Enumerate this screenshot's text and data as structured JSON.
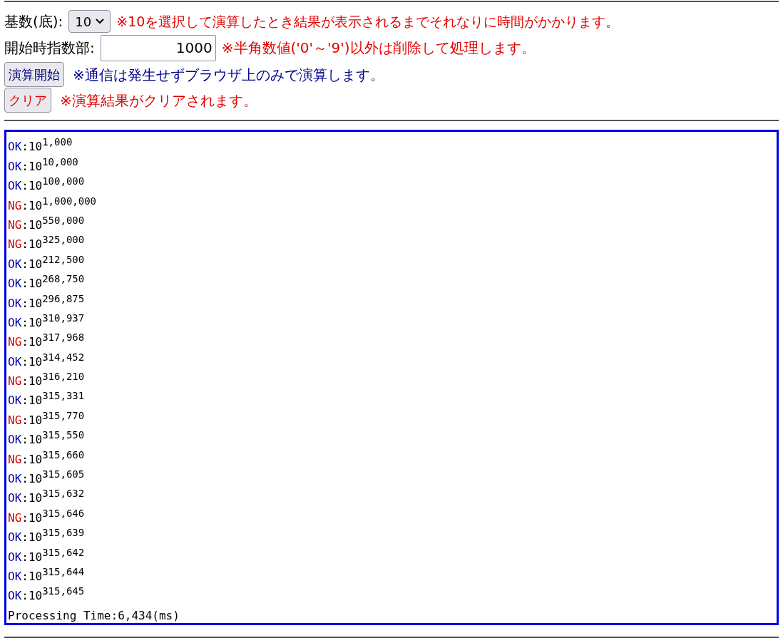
{
  "base_field": {
    "label": "基数(底):",
    "value": "10",
    "note": "※10を選択して演算したとき結果が表示されるまでそれなりに時間がかかります。"
  },
  "exponent_field": {
    "label": "開始時指数部:",
    "value": "1000",
    "note": "※半角数値('0'～'9')以外は削除して処理します。"
  },
  "start_button": {
    "label": "演算開始",
    "note": "※通信は発生せずブラウザ上のみで演算します。"
  },
  "clear_button": {
    "label": "クリア",
    "note": "※演算結果がクリアされます。"
  },
  "results": [
    {
      "status": "OK",
      "ok": true,
      "base": ":10",
      "exponent": "1,000"
    },
    {
      "status": "OK",
      "ok": true,
      "base": ":10",
      "exponent": "10,000"
    },
    {
      "status": "OK",
      "ok": true,
      "base": ":10",
      "exponent": "100,000"
    },
    {
      "status": "NG",
      "ok": false,
      "base": ":10",
      "exponent": "1,000,000"
    },
    {
      "status": "NG",
      "ok": false,
      "base": ":10",
      "exponent": "550,000"
    },
    {
      "status": "NG",
      "ok": false,
      "base": ":10",
      "exponent": "325,000"
    },
    {
      "status": "OK",
      "ok": true,
      "base": ":10",
      "exponent": "212,500"
    },
    {
      "status": "OK",
      "ok": true,
      "base": ":10",
      "exponent": "268,750"
    },
    {
      "status": "OK",
      "ok": true,
      "base": ":10",
      "exponent": "296,875"
    },
    {
      "status": "OK",
      "ok": true,
      "base": ":10",
      "exponent": "310,937"
    },
    {
      "status": "NG",
      "ok": false,
      "base": ":10",
      "exponent": "317,968"
    },
    {
      "status": "OK",
      "ok": true,
      "base": ":10",
      "exponent": "314,452"
    },
    {
      "status": "NG",
      "ok": false,
      "base": ":10",
      "exponent": "316,210"
    },
    {
      "status": "OK",
      "ok": true,
      "base": ":10",
      "exponent": "315,331"
    },
    {
      "status": "NG",
      "ok": false,
      "base": ":10",
      "exponent": "315,770"
    },
    {
      "status": "OK",
      "ok": true,
      "base": ":10",
      "exponent": "315,550"
    },
    {
      "status": "NG",
      "ok": false,
      "base": ":10",
      "exponent": "315,660"
    },
    {
      "status": "OK",
      "ok": true,
      "base": ":10",
      "exponent": "315,605"
    },
    {
      "status": "OK",
      "ok": true,
      "base": ":10",
      "exponent": "315,632"
    },
    {
      "status": "NG",
      "ok": false,
      "base": ":10",
      "exponent": "315,646"
    },
    {
      "status": "OK",
      "ok": true,
      "base": ":10",
      "exponent": "315,639"
    },
    {
      "status": "OK",
      "ok": true,
      "base": ":10",
      "exponent": "315,642"
    },
    {
      "status": "OK",
      "ok": true,
      "base": ":10",
      "exponent": "315,644"
    },
    {
      "status": "OK",
      "ok": true,
      "base": ":10",
      "exponent": "315,645"
    }
  ],
  "processing_time": "Processing Time:6,434(ms)"
}
